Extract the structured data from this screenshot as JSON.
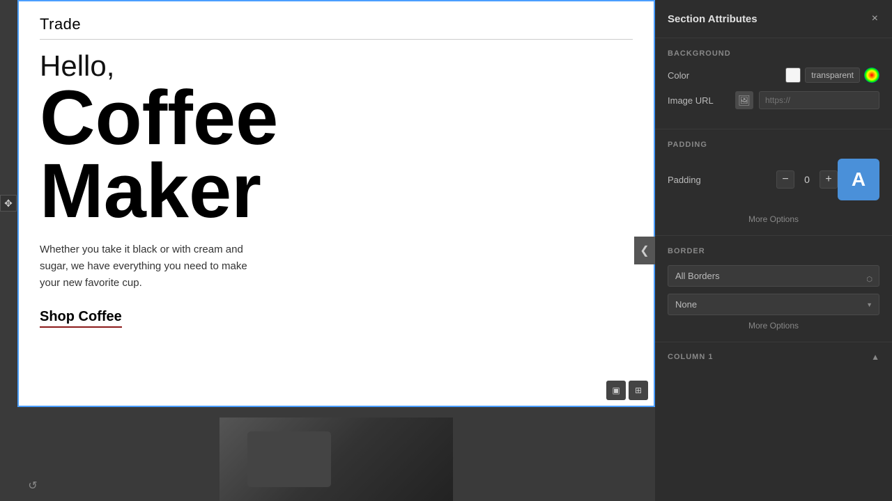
{
  "panel": {
    "title": "Section Attributes",
    "close_label": "×",
    "background": {
      "section_title": "BACKGROUND",
      "color_label": "Color",
      "color_value": "transparent",
      "image_url_label": "Image URL",
      "image_url_placeholder": "https://"
    },
    "padding": {
      "section_title": "PADDING",
      "label": "Padding",
      "value": "0",
      "auto_btn_label": "A",
      "more_options": "More Options"
    },
    "border": {
      "section_title": "BORDER",
      "all_borders_label": "All Borders",
      "none_option": "None",
      "more_options": "More Options"
    },
    "column": {
      "title": "COLUMN 1"
    }
  },
  "canvas": {
    "trade_label": "Trade",
    "hello_text": "Hello,",
    "coffee_text": "Coffee",
    "maker_text": "Maker",
    "description": "Whether you take it black or with cream and sugar, we have everything you need to make your new favorite cup.",
    "shop_coffee_link": "Shop Coffee"
  },
  "icons": {
    "move": "✥",
    "color_picker": "",
    "image": "🖼",
    "close": "✕",
    "refresh": "↺",
    "chevron_left": "❮"
  }
}
